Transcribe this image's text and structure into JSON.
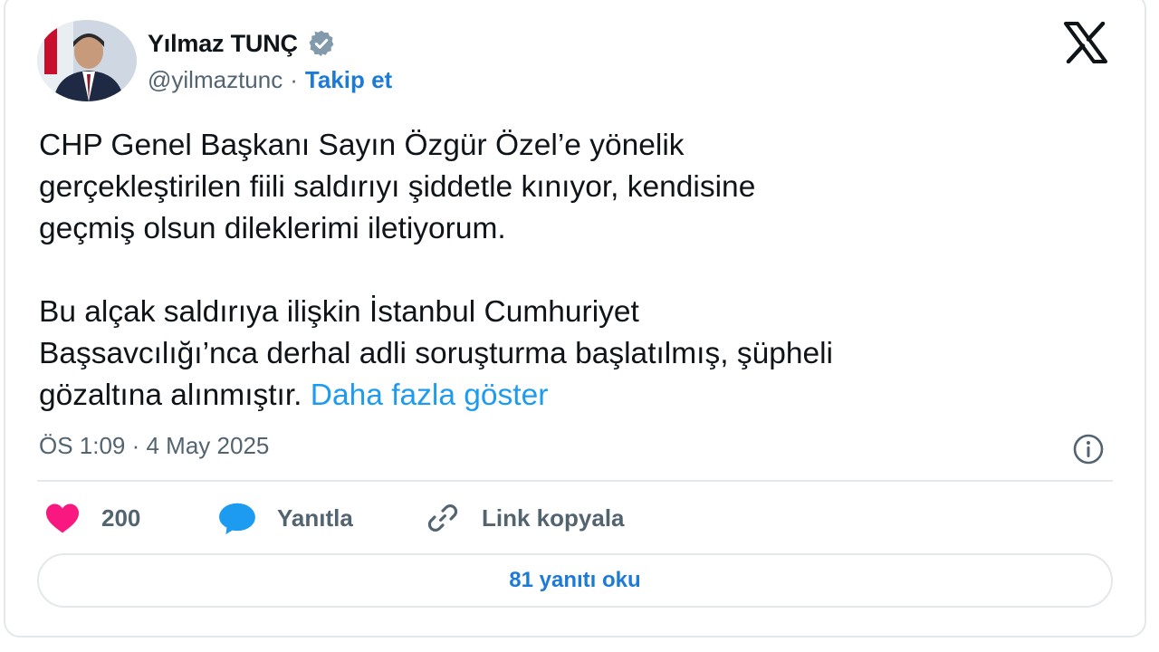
{
  "author": {
    "name": "Yılmaz TUNÇ",
    "handle": "@yilmaztunc",
    "separator": "·",
    "follow_label": "Takip et"
  },
  "icons": {
    "verified": "verified-badge-icon",
    "platform_logo": "x-logo-icon",
    "info": "info-icon",
    "like": "heart-icon",
    "reply": "speech-bubble-icon",
    "copy_link": "link-icon"
  },
  "tweet": {
    "paragraph_1": "CHP Genel Başkanı Sayın Özgür Özel’e yönelik\ngerçekleştirilen fiili saldırıyı şiddetle kınıyor, kendisine\ngeçmiş olsun dileklerimi iletiyorum.",
    "paragraph_2": "Bu alçak saldırıya ilişkin İstanbul Cumhuriyet\nBaşsavcılığı’nca derhal adli soruşturma başlatılmış, şüpheli\ngözaltına alınmıştır. ",
    "show_more_label": "Daha fazla göster"
  },
  "meta": {
    "timestamp": "ÖS 1:09 · 4 May 2025"
  },
  "actions": {
    "like_count": "200",
    "reply_label": "Yanıtla",
    "copy_link_label": "Link kopyala"
  },
  "read_replies_label": "81 yanıtı oku",
  "colors": {
    "accent_blue": "#1d9bf0",
    "like_pink": "#f91880",
    "text_gray": "#536471",
    "border": "#e4e8eb"
  }
}
